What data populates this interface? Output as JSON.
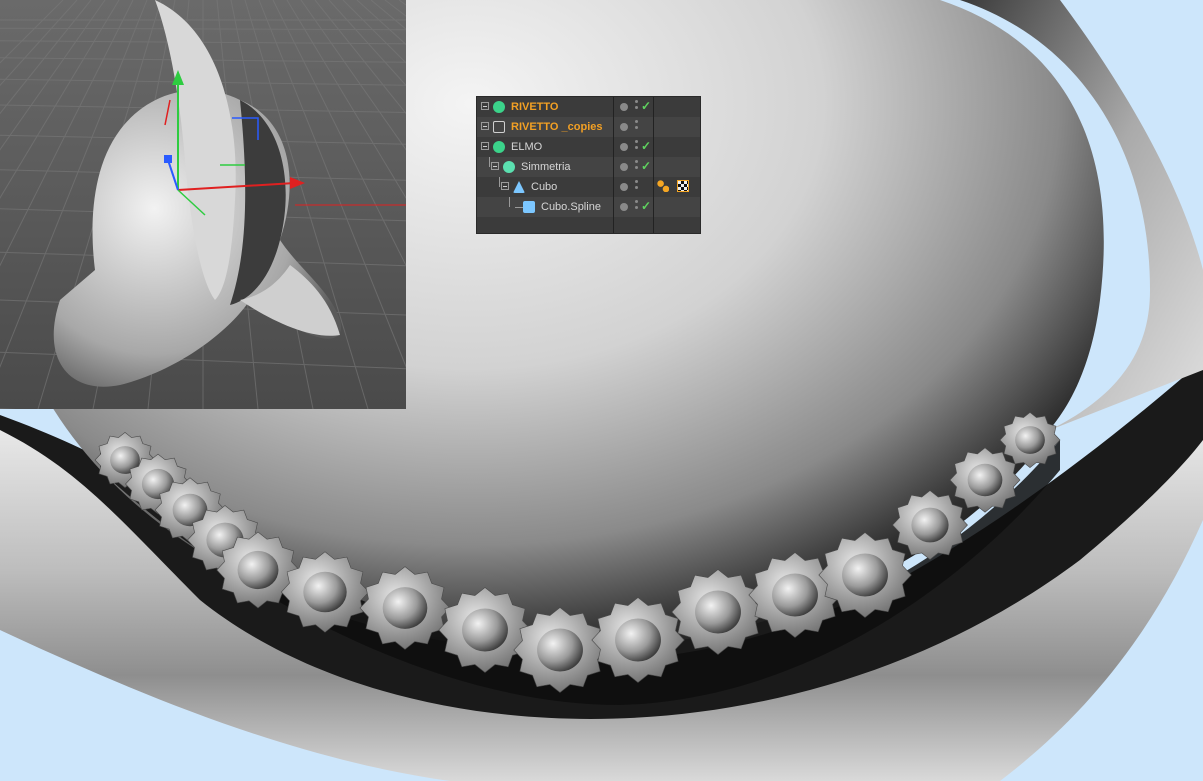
{
  "viewport": {
    "label": "perspective-viewport"
  },
  "object_manager": {
    "rows": [
      {
        "name": "RIVETTO",
        "selected": true,
        "icon": "cloner-icon",
        "expander": "plus",
        "visible_check": true
      },
      {
        "name": "RIVETTO _copies",
        "selected": true,
        "icon": "null-copies-icon",
        "expander": "plus",
        "visible_check": false
      },
      {
        "name": "ELMO",
        "selected": false,
        "icon": "cloner-icon",
        "expander": "minus",
        "visible_check": true
      },
      {
        "name": "Simmetria",
        "selected": false,
        "icon": "symmetry-icon",
        "expander": "minus",
        "visible_check": true
      },
      {
        "name": "Cubo",
        "selected": false,
        "icon": "polygon-cube-icon",
        "expander": "minus",
        "visible_check": false,
        "tags": [
          "phong-tag-icon",
          "material-tag-icon"
        ]
      },
      {
        "name": "Cubo.Spline",
        "selected": false,
        "icon": "spline-icon",
        "expander": "none",
        "visible_check": true
      }
    ]
  },
  "colors": {
    "selected_text": "#f2a024",
    "normal_text": "#d6d6d6",
    "panel_bg": "#3b3b3b",
    "check": "#5fd35f",
    "sky": "#cde6fb"
  }
}
